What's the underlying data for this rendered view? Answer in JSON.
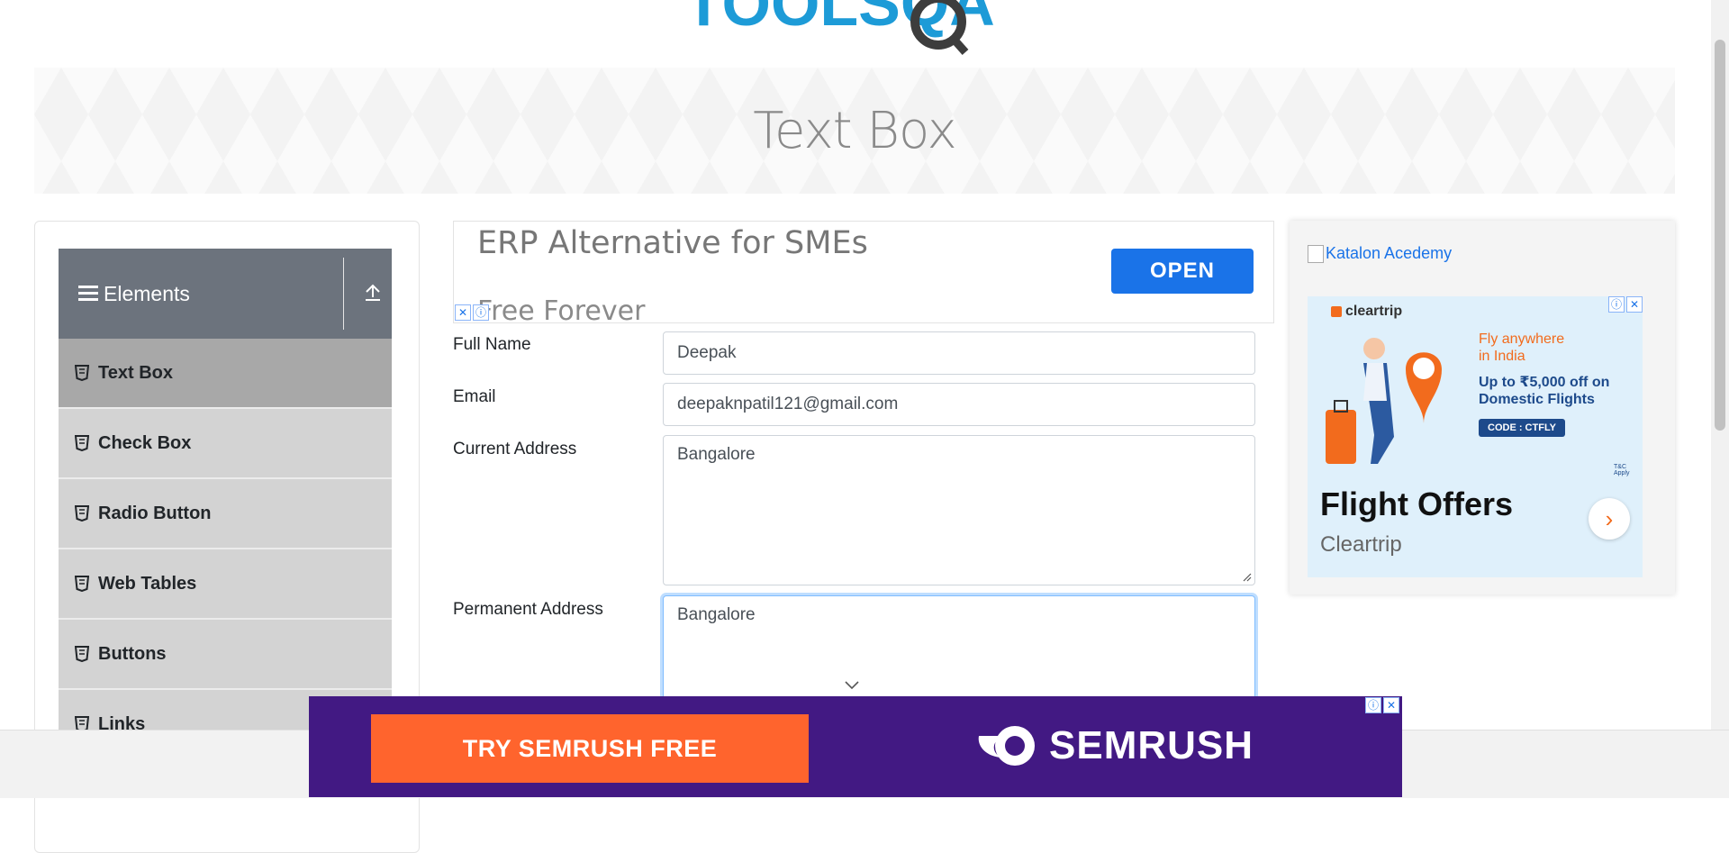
{
  "header": {
    "logo_text": "TOOLSQA"
  },
  "banner": {
    "title": "Text Box"
  },
  "sidebar": {
    "group_title": "Elements",
    "items": [
      {
        "label": "Text Box",
        "active": true
      },
      {
        "label": "Check Box"
      },
      {
        "label": "Radio Button"
      },
      {
        "label": "Web Tables"
      },
      {
        "label": "Buttons"
      },
      {
        "label": "Links"
      }
    ]
  },
  "top_ad": {
    "headline": "ERP Alternative for SMEs",
    "subline": "Free Forever",
    "cta": "OPEN"
  },
  "form": {
    "full_name": {
      "label": "Full Name",
      "value": "Deepak"
    },
    "email": {
      "label": "Email",
      "value": "deepaknpatil121@gmail.com"
    },
    "current_address": {
      "label": "Current Address",
      "value": "Bangalore"
    },
    "permanent_address": {
      "label": "Permanent Address",
      "value": "Bangalore"
    }
  },
  "right_ad": {
    "katalon_alt": "Katalon Acedemy",
    "brand": "cleartrip",
    "fly_text": "Fly anywhere in India",
    "offer_text": "Up to ₹5,000 off on Domestic Flights",
    "code": "CODE : CTFLY",
    "tnc": "T&C Apply",
    "title": "Flight Offers",
    "subtitle": "Cleartrip"
  },
  "bottom_ad": {
    "cta": "TRY SEMRUSH FREE",
    "brand": "SEMRUSH"
  },
  "colors": {
    "accent_blue": "#1a73e8",
    "semrush_purple": "#421983",
    "semrush_orange": "#ff642d",
    "nav_header": "#6c737d"
  }
}
